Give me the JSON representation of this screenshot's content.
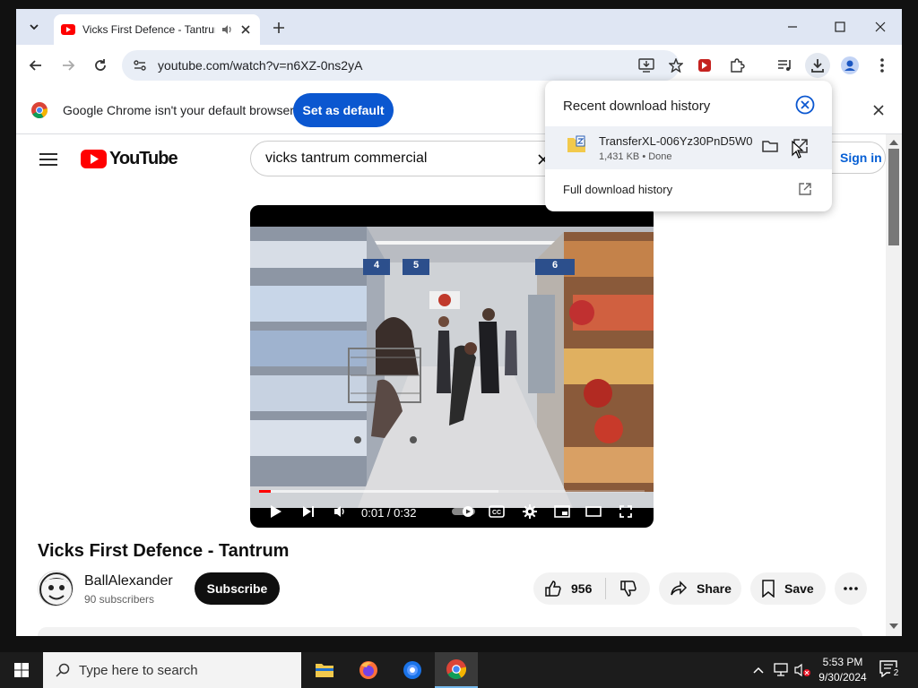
{
  "browser": {
    "tab_title": "Vicks First Defence - Tantrum",
    "url": "youtube.com/watch?v=n6XZ-0ns2yA"
  },
  "infobar": {
    "message": "Google Chrome isn't your default browser",
    "set_default_label": "Set as default"
  },
  "youtube": {
    "logo_text": "YouTube",
    "search_query": "vicks tantrum commercial",
    "signin_label": "Sign in",
    "video_title": "Vicks First Defence - Tantrum",
    "channel_name": "BallAlexander",
    "subscribers": "90 subscribers",
    "subscribe_label": "Subscribe",
    "likes": "956",
    "share_label": "Share",
    "save_label": "Save",
    "player": {
      "time": "0:01 / 0:32",
      "progress_fraction": 0.03,
      "buffered_fraction": 0.62,
      "aisle_signs": [
        "4",
        "5",
        "6"
      ]
    }
  },
  "downloads": {
    "header": "Recent download history",
    "file_name": "TransferXL-006Yz30PnD5W0",
    "file_status": "1,431 KB • Done",
    "full_history_label": "Full download history"
  },
  "taskbar": {
    "search_placeholder": "Type here to search",
    "time": "5:53 PM",
    "date": "9/30/2024",
    "notification_count": "2"
  },
  "colors": {
    "youtube_red": "#ff0000",
    "chrome_blue": "#0b57d0",
    "tab_strip": "#dfe6f3",
    "taskbar": "#1c1c1c"
  }
}
